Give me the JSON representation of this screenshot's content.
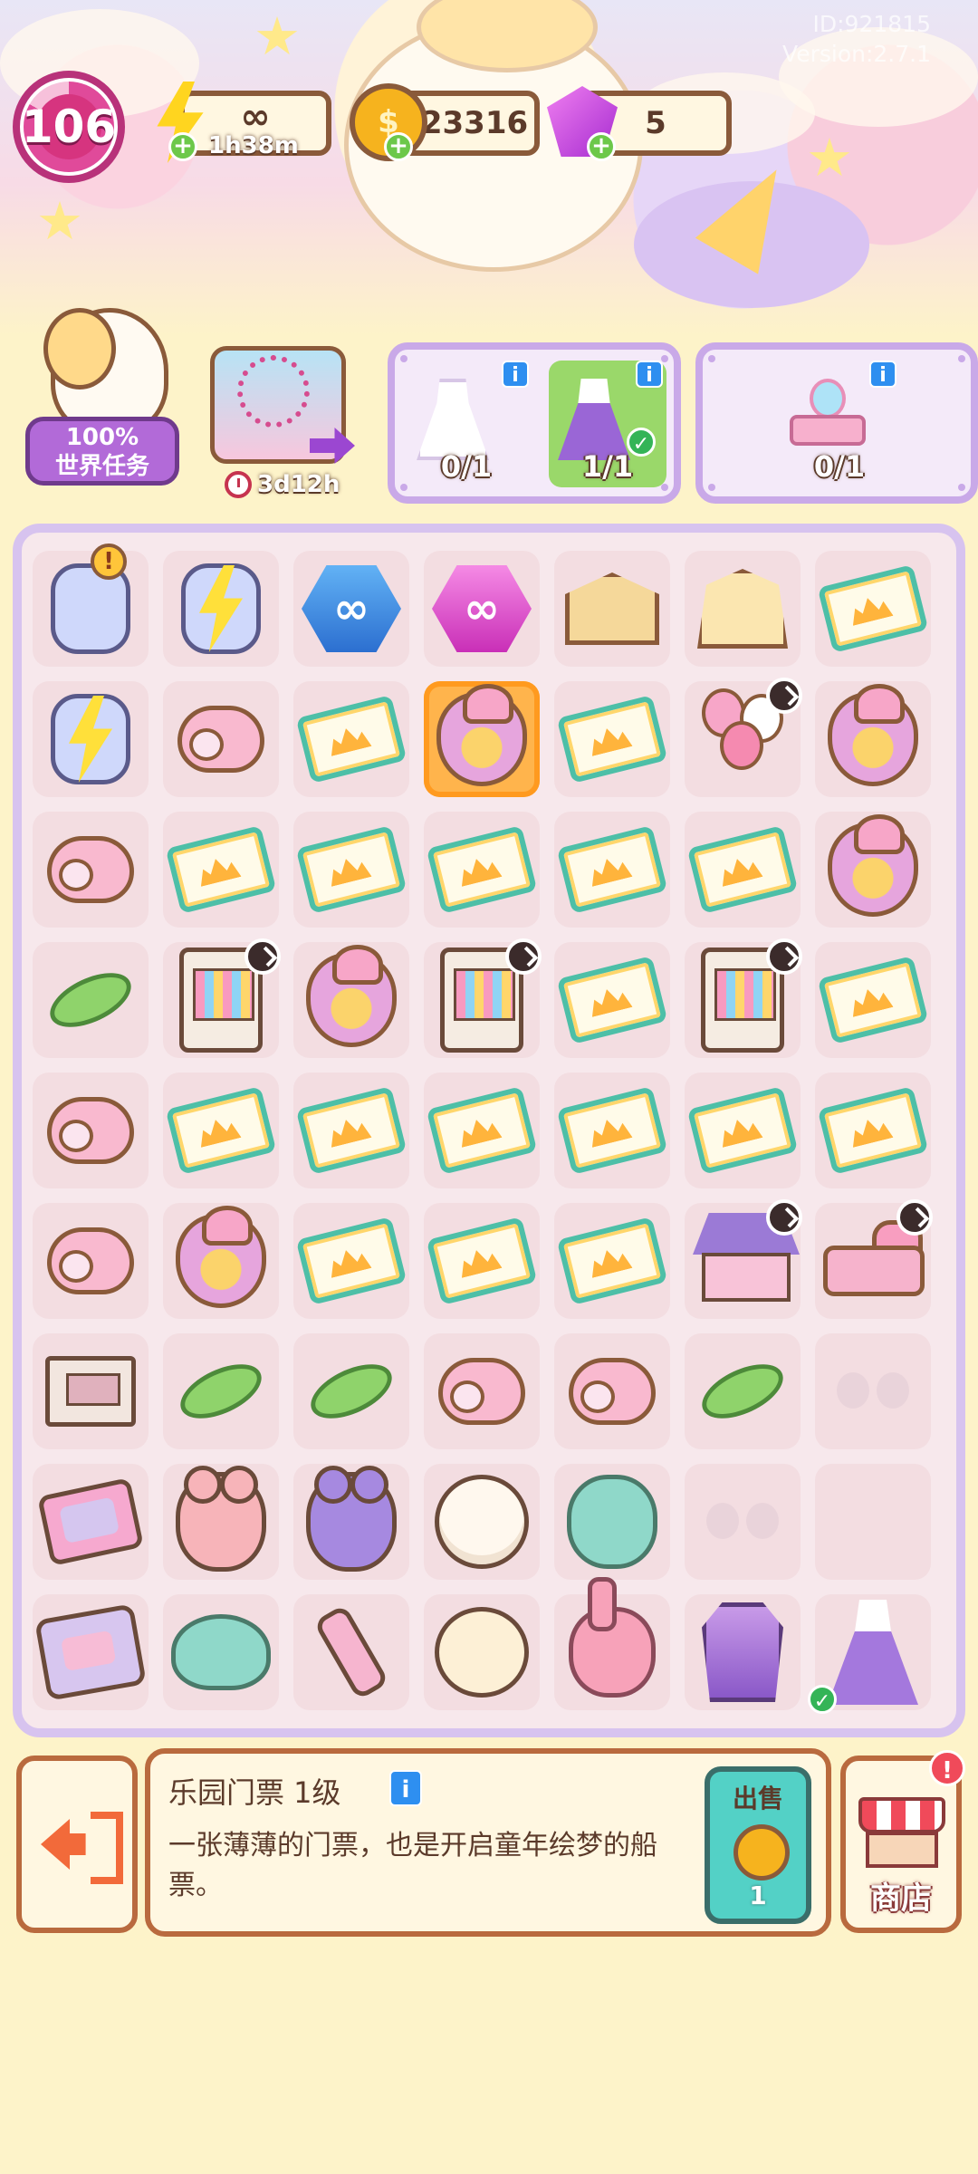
{
  "header": {
    "player_id": "ID:921815",
    "version": "Version:2.7.1"
  },
  "hud": {
    "level": "106",
    "energy": {
      "value": "∞",
      "timer": "1h38m",
      "icon": "lightning-bolt"
    },
    "coins": {
      "value": "23316",
      "icon": "gold-coin"
    },
    "gems": {
      "value": "5",
      "icon": "purple-gem"
    }
  },
  "world_task": {
    "progress": "100%",
    "label": "世界任务"
  },
  "park_event": {
    "timer": "3d12h"
  },
  "orders": [
    {
      "items": [
        {
          "name": "white-dress",
          "count": "0/1",
          "done": false
        },
        {
          "name": "purple-gown",
          "count": "1/1",
          "done": true
        }
      ]
    },
    {
      "items": [
        {
          "name": "vanity-table",
          "count": "0/1",
          "done": false
        }
      ]
    }
  ],
  "board": {
    "rows": [
      [
        "jar-bubble",
        "jar-energy",
        "infinity-blue",
        "infinity-pink",
        "cardboard",
        "box-open",
        "ticket"
      ],
      [
        "jar-energy2",
        "roll",
        "ticket",
        "bag-selected",
        "ticket",
        "balloons-timer",
        "bag"
      ],
      [
        "roll",
        "ticket",
        "ticket",
        "ticket",
        "ticket-stack",
        "ticket",
        "bag"
      ],
      [
        "candy",
        "wardrobe-timer",
        "bag",
        "wardrobe-timer",
        "ticket",
        "wardrobe-timer",
        "ticket"
      ],
      [
        "roll",
        "ticket",
        "ticket",
        "ticket",
        "ticket",
        "ticket",
        "ticket"
      ],
      [
        "roll",
        "bag",
        "ticket",
        "ticket",
        "ticket",
        "house-timer",
        "bed-timer"
      ],
      [
        "drawer",
        "candy",
        "candy",
        "roll",
        "roll",
        "candy",
        "ribbon-empty"
      ],
      [
        "compact",
        "bear-pink",
        "bear-purple",
        "sheep",
        "elephant",
        "ribbon-empty",
        "empty"
      ],
      [
        "mirror-box",
        "seal",
        "roller",
        "dog",
        "bunny",
        "coat",
        "gown-check"
      ]
    ]
  },
  "info_panel": {
    "title": "乐园门票 1级",
    "description": "一张薄薄的门票，也是开启童年绘梦的船票。",
    "sell_label": "出售",
    "sell_price": "1"
  },
  "shop": {
    "label": "商店",
    "alert": "!"
  },
  "colors": {
    "background": "#fdf3c9",
    "board_border": "#d7c3ef",
    "board_fill": "#f7e8ec",
    "accent_brown": "#b96a3e",
    "sell_teal": "#53d1c6"
  }
}
